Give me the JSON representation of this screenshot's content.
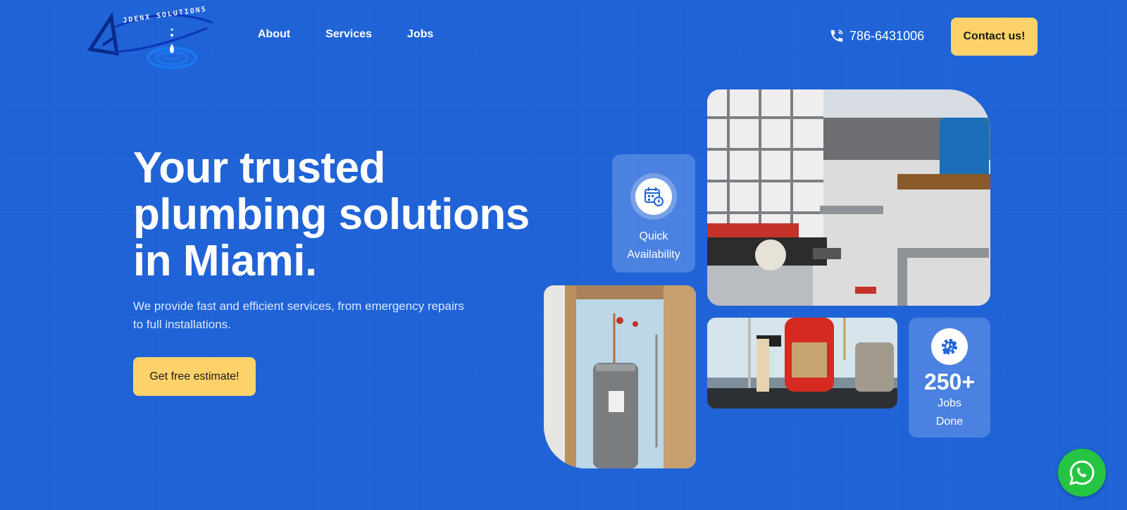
{
  "brand": {
    "logo_text": "JDENX SOLUTIONS"
  },
  "nav": {
    "items": [
      {
        "label": "About"
      },
      {
        "label": "Services"
      },
      {
        "label": "Jobs"
      }
    ]
  },
  "header": {
    "phone": "786-6431006",
    "contact_label": "Contact us!"
  },
  "hero": {
    "title_line1": "Your trusted",
    "title_line2": "plumbing solutions",
    "title_line3": "in Miami.",
    "subtitle_line1": "We provide fast and efficient services, from emergency repairs",
    "subtitle_line2": "to full installations.",
    "cta_label": "Get free estimate!"
  },
  "cards": {
    "availability": {
      "line1": "Quick",
      "line2": "Availability",
      "icon": "calendar-clock-icon"
    },
    "jobs": {
      "count": "250+",
      "line1": "Jobs",
      "line2": "Done",
      "icon": "wrench-gear-icon"
    }
  },
  "colors": {
    "background": "#1f63d6",
    "accent": "#fdd26a",
    "whatsapp": "#26c443"
  }
}
